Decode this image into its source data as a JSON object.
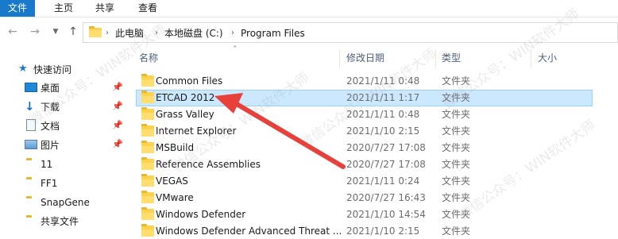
{
  "ribbon": {
    "tabs": [
      "文件",
      "主页",
      "共享",
      "查看"
    ]
  },
  "address": {
    "crumbs": [
      "此电脑",
      "本地磁盘 (C:)",
      "Program Files"
    ],
    "separator": "›"
  },
  "columns": {
    "name": "名称",
    "date": "修改日期",
    "type": "类型",
    "size": "大小"
  },
  "nav": {
    "quick_access": "快速访问",
    "items": [
      {
        "label": "桌面",
        "icon": "desktop-icon",
        "pinned": true
      },
      {
        "label": "下载",
        "icon": "download-icon",
        "pinned": true
      },
      {
        "label": "文档",
        "icon": "document-icon",
        "pinned": true
      },
      {
        "label": "图片",
        "icon": "picture-icon",
        "pinned": true
      },
      {
        "label": "11",
        "icon": "folder-icon",
        "pinned": false
      },
      {
        "label": "FF1",
        "icon": "folder-icon",
        "pinned": false
      },
      {
        "label": "SnapGene",
        "icon": "folder-icon",
        "pinned": false
      },
      {
        "label": "共享文件",
        "icon": "folder-icon",
        "pinned": false
      }
    ]
  },
  "files": [
    {
      "name": "Common Files",
      "date": "2021/1/11 0:48",
      "type": "文件夹"
    },
    {
      "name": "ETCAD 2012",
      "date": "2021/1/11 1:17",
      "type": "文件夹",
      "selected": true
    },
    {
      "name": "Grass Valley",
      "date": "2021/1/11 0:48",
      "type": "文件夹"
    },
    {
      "name": "Internet Explorer",
      "date": "2021/1/10 2:15",
      "type": "文件夹"
    },
    {
      "name": "MSBuild",
      "date": "2020/7/27 17:08",
      "type": "文件夹"
    },
    {
      "name": "Reference Assemblies",
      "date": "2020/7/27 17:08",
      "type": "文件夹"
    },
    {
      "name": "VEGAS",
      "date": "2021/1/11 0:24",
      "type": "文件夹"
    },
    {
      "name": "VMware",
      "date": "2020/7/27 16:43",
      "type": "文件夹"
    },
    {
      "name": "Windows Defender",
      "date": "2021/1/10 14:54",
      "type": "文件夹"
    },
    {
      "name": "Windows Defender Advanced Threat ...",
      "date": "2021/1/10 2:15",
      "type": "文件夹"
    }
  ],
  "watermark": "微信公众号：WIN软件大师",
  "colors": {
    "file_tab": "#1979ca",
    "selection": "#cce8ff",
    "arrow": "#e8413c",
    "folder": "#ffd24d"
  }
}
